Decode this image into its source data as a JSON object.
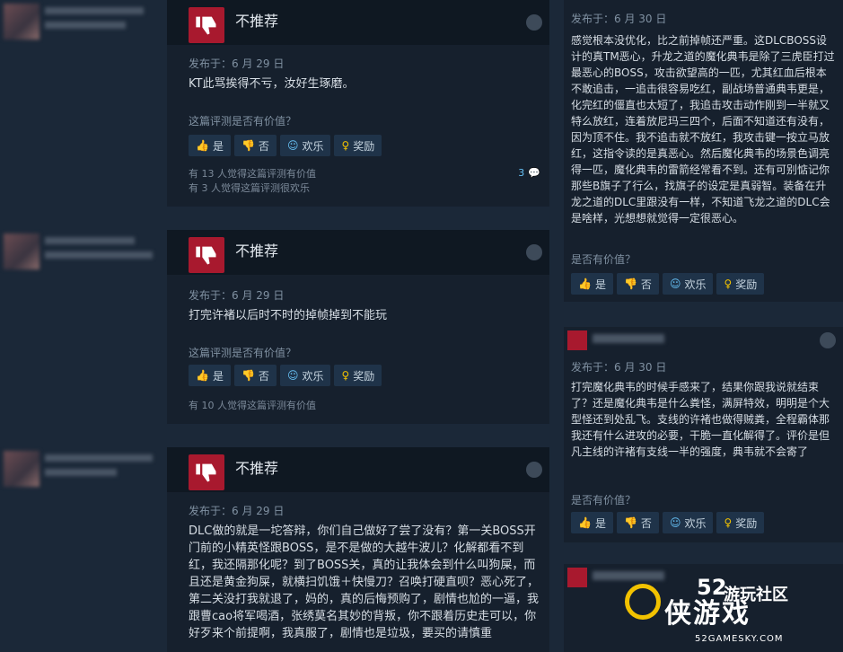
{
  "left_reviews": [
    {
      "verdict": "不推荐",
      "posted": "发布于：6 月 29 日",
      "text": "KT此骂挨得不亏，汝好生琢磨。",
      "helpful_question": "这篇评测是否有价值？",
      "buttons": {
        "yes": "是",
        "no": "否",
        "funny": "欢乐",
        "award": "奖励"
      },
      "stats": [
        "有 13 人觉得这篇评测有价值",
        "有 3 人觉得这篇评测很欢乐"
      ],
      "comments": "3"
    },
    {
      "verdict": "不推荐",
      "posted": "发布于：6 月 29 日",
      "text": "打完许褚以后时不时的掉帧掉到不能玩",
      "helpful_question": "这篇评测是否有价值？",
      "buttons": {
        "yes": "是",
        "no": "否",
        "funny": "欢乐",
        "award": "奖励"
      },
      "stats": [
        "有 10 人觉得这篇评测有价值"
      ]
    },
    {
      "verdict": "不推荐",
      "posted": "发布于：6 月 29 日",
      "text": "DLC做的就是一坨答辩，你们自己做好了尝了没有？第一关BOSS开门前的小精英怪跟BOSS，是不是做的大越牛波儿？化解都看不到红，我还隔那化呢？到了BOSS关，真的让我体会到什么叫狗屎，而且还是黄金狗屎，就横扫饥饿＋快慢刀？召唤打硬直呗？恶心死了，第二关没打我就退了，妈的，真的后悔预购了，剧情也尬的一逼，我跟曹cao将军喝酒，张绣莫名其妙的背叛，你不跟着历史走可以，你好歹来个前提啊，我真服了，剧情也是垃圾，要买的请慎重"
    }
  ],
  "right_reviews": [
    {
      "posted": "发布于：6 月 30 日",
      "text": "感觉根本没优化，比之前掉帧还严重。这DLCBOSS设计的真TM恶心，升龙之道的魔化典韦是除了三虎臣打过最恶心的BOSS，攻击欲望高的一匹，尤其红血后根本不敢追击，一追击很容易吃红，副战场普通典韦更是，化完红的僵直也太短了，我追击攻击动作刚到一半就又特么放红，连着放尼玛三四个，后面不知道还有没有，因为顶不住。我不追击就不放红，我攻击键一按立马放红，这指令读的是真恶心。然后魔化典韦的场景色调亮得一匹，魔化典韦的雷箭经常看不到。还有可别惦记你那些B旗子了行么，找旗子的设定是真弱智。装备在升龙之道的DLC里跟没有一样，不知道飞龙之道的DLC会是啥样，光想想就觉得一定很恶心。",
      "helpful_question": "是否有价值？",
      "buttons": {
        "yes": "是",
        "no": "否",
        "funny": "欢乐",
        "award": "奖励"
      }
    },
    {
      "posted": "发布于：6 月 30 日",
      "text": "打完魔化典韦的时候手感来了，结果你跟我说就结束了？还是魔化典韦是什么粪怪，满屏特效，明明是个大型怪还到处乱飞。支线的许褚也做得贼粪，全程霸体那我还有什么进攻的必要，干脆一直化解得了。评价是但凡主线的许褚有支线一半的强度，典韦就不会寄了",
      "helpful_question": "是否有价值？",
      "buttons": {
        "yes": "是",
        "no": "否",
        "funny": "欢乐",
        "award": "奖励"
      }
    }
  ],
  "watermark": {
    "num": "52",
    "sub": "游玩社区",
    "big": "侠游戏",
    "url": "52GAMESKY.COM"
  }
}
